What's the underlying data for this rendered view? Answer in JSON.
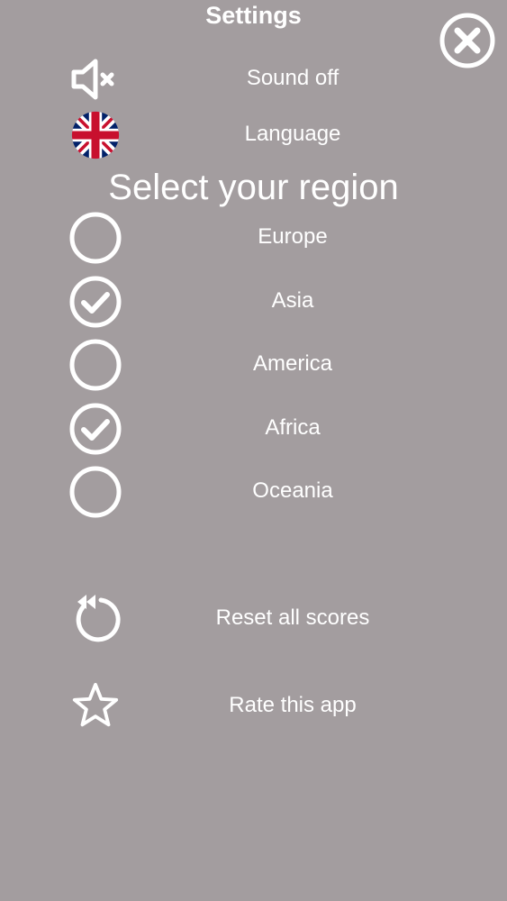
{
  "header": {
    "title": "Settings",
    "close_icon": "close-circle-icon"
  },
  "sound": {
    "label": "Sound off",
    "icon": "speaker-muted-icon"
  },
  "language": {
    "label": "Language",
    "icon": "uk-flag-icon"
  },
  "region": {
    "heading": "Select your region",
    "items": [
      {
        "label": "Europe",
        "checked": false
      },
      {
        "label": "Asia",
        "checked": true
      },
      {
        "label": "America",
        "checked": false
      },
      {
        "label": "Africa",
        "checked": true
      },
      {
        "label": "Oceania",
        "checked": false
      }
    ]
  },
  "actions": {
    "reset_label": "Reset all scores",
    "reset_icon": "reset-icon",
    "rate_label": "Rate this app",
    "rate_icon": "star-icon"
  },
  "colors": {
    "background": "#a39d9f",
    "foreground": "#ffffff",
    "flag_blue": "#012169",
    "flag_red": "#c8102e"
  }
}
